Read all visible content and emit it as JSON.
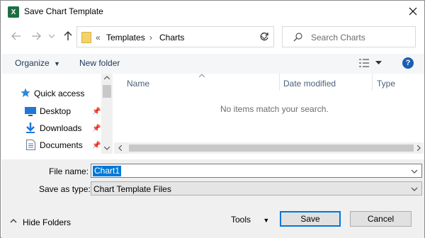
{
  "window": {
    "title": "Save Chart Template",
    "app_icon": "excel-icon"
  },
  "address_bar": {
    "overflow": "«",
    "crumbs": [
      "Templates",
      "Charts"
    ]
  },
  "search": {
    "placeholder": "Search Charts"
  },
  "toolbar": {
    "organize_label": "Organize",
    "new_folder_label": "New folder"
  },
  "nav_pane": {
    "items": [
      {
        "label": "Quick access",
        "icon": "star-icon"
      },
      {
        "label": "Desktop",
        "icon": "desktop-icon",
        "pinned": true
      },
      {
        "label": "Downloads",
        "icon": "download-icon",
        "pinned": true
      },
      {
        "label": "Documents",
        "icon": "document-icon",
        "pinned": true
      }
    ]
  },
  "file_list": {
    "columns": [
      "Name",
      "Date modified",
      "Type"
    ],
    "empty_message": "No items match your search."
  },
  "form": {
    "file_name_label": "File name:",
    "file_name_value": "Chart1",
    "save_type_label": "Save as type:",
    "save_type_value": "Chart Template Files"
  },
  "footer": {
    "hide_folders_label": "Hide Folders",
    "tools_label": "Tools",
    "save_label": "Save",
    "cancel_label": "Cancel"
  },
  "colors": {
    "accent": "#0078d7",
    "toolbar_text": "#1e395b",
    "excel_green": "#1d6f42"
  }
}
